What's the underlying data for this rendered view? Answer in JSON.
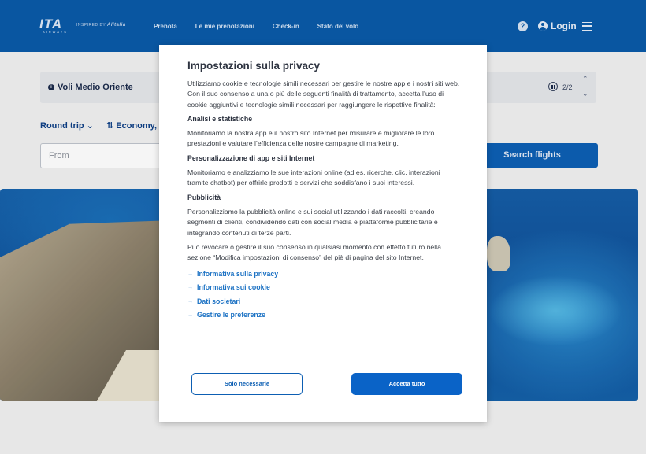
{
  "header": {
    "logo_main": "ITA",
    "logo_sub": "AIRWAYS",
    "inspired_prefix": "INSPIRED BY",
    "inspired_brand": "Alitalia",
    "nav": [
      "Prenota",
      "Le mie prenotazioni",
      "Check-in",
      "Stato del volo"
    ],
    "help_glyph": "?",
    "login_label": "Login"
  },
  "announcement": {
    "info_glyph": "i",
    "text": "Voli Medio Oriente",
    "counter": "2/2"
  },
  "booking": {
    "trip_type": "Round trip ⌄",
    "cabin": "⇅ Economy, 1",
    "from_placeholder": "From",
    "search_label": "Search flights"
  },
  "privacy": {
    "title": "Impostazioni sulla privacy",
    "intro": "Utilizziamo cookie e tecnologie simili necessari per gestire le nostre app e i nostri siti web. Con il suo consenso a una o più delle seguenti finalità di trattamento, accetta l’uso di cookie aggiuntivi e tecnologie simili necessari per raggiungere le rispettive finalità:",
    "sections": [
      {
        "heading": "Analisi e statistiche",
        "text": "Monitoriamo la nostra app e il nostro sito Internet per misurare e migliorare le loro prestazioni e valutare l’efficienza delle nostre campagne di marketing."
      },
      {
        "heading": "Personalizzazione di app e siti Internet",
        "text": "Monitoriamo e analizziamo le sue interazioni online (ad es. ricerche, clic, interazioni tramite chatbot) per offrirle prodotti e servizi che soddisfano i suoi interessi."
      },
      {
        "heading": "Pubblicità",
        "text": "Personalizziamo la pubblicità online e sui social utilizzando i dati raccolti, creando segmenti di clienti, condividendo dati con social media e piattaforme pubblicitarie e integrando contenuti di terze parti."
      }
    ],
    "outro": "Può revocare o gestire il suo consenso in qualsiasi momento con effetto futuro nella sezione “Modifica impostazioni di consenso” del piè di pagina del sito Internet.",
    "links": [
      "Informativa sulla privacy",
      "Informativa sui cookie",
      "Dati societari",
      "Gestire le preferenze"
    ],
    "btn_necessary": "Solo necessarie",
    "btn_accept": "Accetta tutto"
  }
}
